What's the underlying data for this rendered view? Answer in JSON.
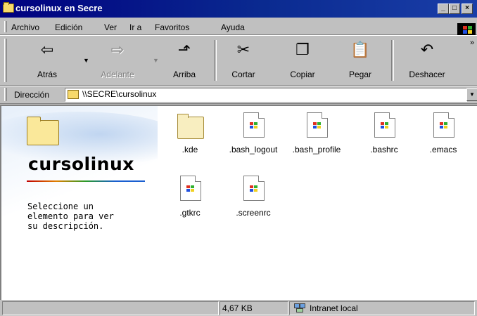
{
  "window": {
    "title": "cursolinux en Secre"
  },
  "menu": [
    "Archivo",
    "Edición",
    "Ver",
    "Ir a",
    "Favoritos",
    "Ayuda"
  ],
  "toolbar": {
    "back": "Atrás",
    "forward": "Adelante",
    "up": "Arriba",
    "cut": "Cortar",
    "copy": "Copiar",
    "paste": "Pegar",
    "undo": "Deshacer"
  },
  "address": {
    "label": "Dirección",
    "value": "\\\\SECRE\\cursolinux"
  },
  "webview": {
    "folder_name": "cursolinux",
    "description": "Seleccione un\nelemento para ver\nsu descripción."
  },
  "files": [
    ".kde",
    ".bash_logout",
    ".bash_profile",
    ".bashrc",
    ".emacs",
    ".gtkrc",
    ".screenrc"
  ],
  "status": {
    "size": "4,67 KB",
    "zone": "Intranet local"
  },
  "colors": {
    "titlebar": "#000080",
    "face": "#c0c0c0",
    "content_bg": "#ffffff"
  }
}
